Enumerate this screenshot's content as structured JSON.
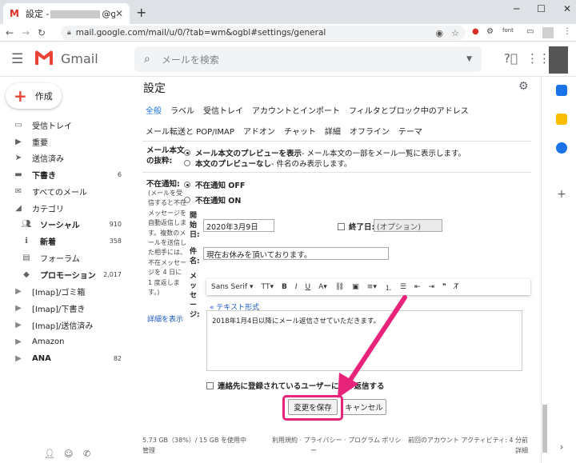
{
  "browser": {
    "tab_title_prefix": "設定 -",
    "tab_title_suffix": "@gmail.c",
    "url": "mail.google.com/mail/u/0/?tab=wm&ogbl#settings/general",
    "font_ext": "font"
  },
  "gmail": {
    "logo_text": "Gmail",
    "search_placeholder": "メールを検索"
  },
  "sidebar": {
    "compose_label": "作成",
    "items": [
      {
        "label": "受信トレイ",
        "count": "",
        "icon": "inbox-icon"
      },
      {
        "label": "重要",
        "count": "",
        "icon": "important-icon"
      },
      {
        "label": "送信済み",
        "count": "",
        "icon": "sent-icon"
      },
      {
        "label": "下書き",
        "count": "6",
        "icon": "draft-icon"
      },
      {
        "label": "すべてのメール",
        "count": "",
        "icon": "all-mail-icon"
      },
      {
        "label": "カテゴリ",
        "count": "",
        "icon": "category-icon"
      },
      {
        "label": "ソーシャル",
        "count": "910",
        "icon": "social-icon"
      },
      {
        "label": "新着",
        "count": "358",
        "icon": "updates-icon"
      },
      {
        "label": "フォーラム",
        "count": "",
        "icon": "forums-icon"
      },
      {
        "label": "プロモーション",
        "count": "2,017",
        "icon": "promotions-icon"
      },
      {
        "label": "[Imap]/ゴミ箱",
        "count": "",
        "icon": "label-icon"
      },
      {
        "label": "[Imap]/下書き",
        "count": "",
        "icon": "label-icon"
      },
      {
        "label": "[Imap]/送信済み",
        "count": "",
        "icon": "label-icon"
      },
      {
        "label": "Amazon",
        "count": "",
        "icon": "label-icon"
      },
      {
        "label": "ANA",
        "count": "82",
        "icon": "label-icon"
      }
    ]
  },
  "settings": {
    "title": "設定",
    "tabs_row1": [
      "全般",
      "ラベル",
      "受信トレイ",
      "アカウントとインポート",
      "フィルタとブロック中のアドレス"
    ],
    "tabs_row2": [
      "メール転送と POP/IMAP",
      "アドオン",
      "チャット",
      "詳細",
      "オフライン",
      "テーマ"
    ],
    "snippet_label_1": "メール本文",
    "snippet_label_2": "の抜粋:",
    "snippet_opt1_bold": "メール本文のプレビューを表示",
    "snippet_opt1_rest": " - メール本文の一部をメール一覧に表示します。",
    "snippet_opt2_bold": "本文のプレビューなし",
    "snippet_opt2_rest": " - 件名のみ表示します。",
    "vacation_label": "不在通知:",
    "vacation_help": "(メールを受信すると不在メッセージを自動返信します。複数のメールを送信した相手には、不在メッセージを 4 日に 1 度返します。)",
    "details_link": "詳細を表示",
    "vacation_off": "不在通知 OFF",
    "vacation_on": "不在通知 ON",
    "start_label": "開始日:",
    "start_date": "2020年3月9日",
    "end_label": "終了日:",
    "end_placeholder": "(オプション)",
    "subject_label": "件名:",
    "subject_value": "現在お休みを頂いております。",
    "message_label": "メッセージ:",
    "font_name": "Sans Serif",
    "plain_text_link": "« テキスト形式",
    "message_body": "2018年1月4日以降にメール返信させていただきます。",
    "contacts_only": "連絡先に登録されているユーザーにのみ返信する",
    "save_button": "変更を保存",
    "cancel_button": "キャンセル",
    "footer_storage_1": "5.73 GB（38%）/ 15 GB を使用中",
    "footer_storage_2": "管理",
    "footer_terms": "利用規約 · プライバシー · プログラム ポリシ",
    "footer_terms_2": "ー",
    "footer_activity_1": "前回のアカウント アクティビティ: 4 分前",
    "footer_activity_2": "詳細"
  },
  "colors": {
    "accent": "#1a73e8",
    "highlight": "#e8247a",
    "gmail_red": "#ea4335"
  }
}
